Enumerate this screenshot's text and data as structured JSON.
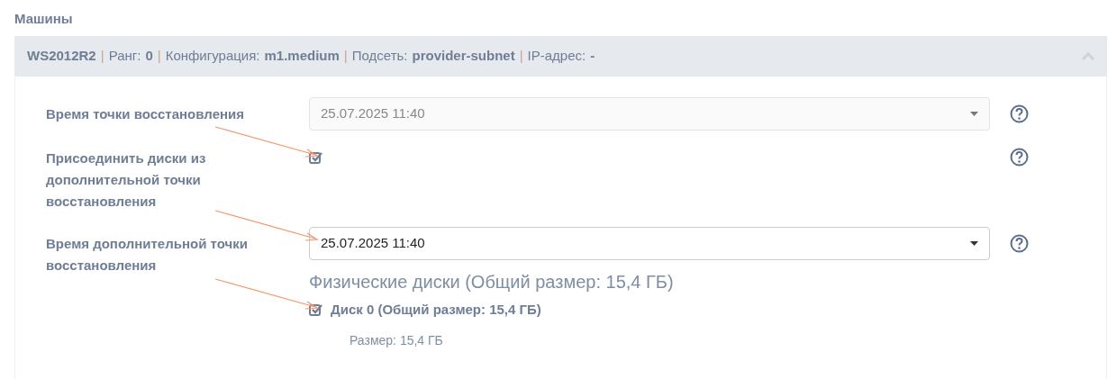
{
  "section_title": "Машины",
  "machine": {
    "name": "WS2012R2",
    "separator": "|",
    "expanded": true,
    "fields": [
      {
        "label": "Ранг:",
        "value": "0"
      },
      {
        "label": "Конфигурация:",
        "value": "m1.medium"
      },
      {
        "label": "Подсеть:",
        "value": "provider-subnet"
      },
      {
        "label": "IP-адрес:",
        "value": "-"
      }
    ]
  },
  "form": {
    "rows": [
      {
        "kind": "select",
        "label": "Время точки восстановления",
        "value": "25.07.2025 11:40",
        "disabled": true
      },
      {
        "kind": "checkbox",
        "label": "Присоединить диски из дополнительной точки восстановления",
        "checked": true
      },
      {
        "kind": "select",
        "label": "Время дополнительной точки восстановления",
        "value": "25.07.2025 11:40",
        "disabled": false
      }
    ]
  },
  "disks": {
    "title": "Физические диски (Общий размер: 15,4 ГБ)",
    "items": [
      {
        "label": "Диск 0 (Общий размер: 15,4 ГБ)",
        "checked": true,
        "size": "Размер: 15,4 ГБ"
      }
    ]
  }
}
